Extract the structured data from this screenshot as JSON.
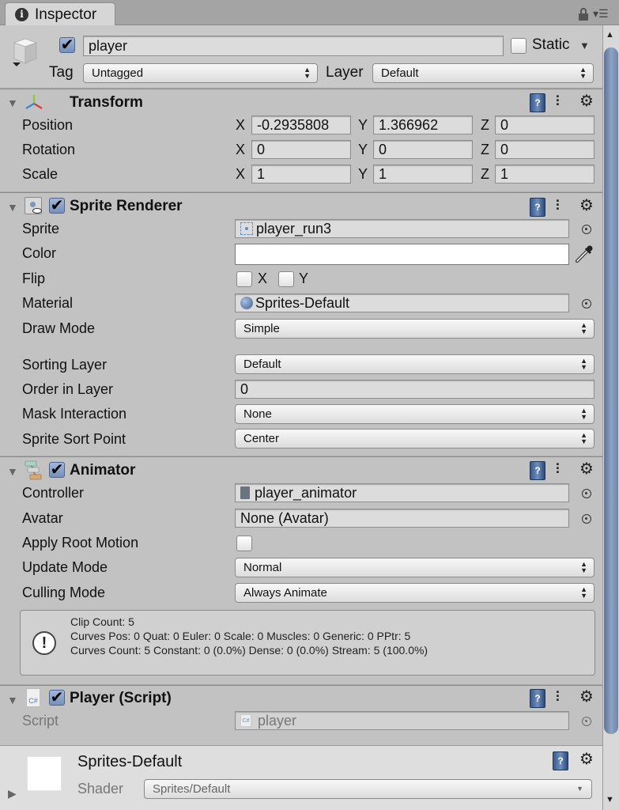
{
  "window": {
    "tab_label": "Inspector",
    "icons": [
      "info-icon",
      "lock-icon",
      "menu-icon"
    ]
  },
  "gameobject": {
    "active": true,
    "name": "player",
    "static_label": "Static",
    "static": false,
    "tag_label": "Tag",
    "tag_value": "Untagged",
    "layer_label": "Layer",
    "layer_value": "Default"
  },
  "transform": {
    "title": "Transform",
    "rows": [
      {
        "label": "Position",
        "x": "-0.2935808",
        "y": "1.366962",
        "z": "0"
      },
      {
        "label": "Rotation",
        "x": "0",
        "y": "0",
        "z": "0"
      },
      {
        "label": "Scale",
        "x": "1",
        "y": "1",
        "z": "1"
      }
    ],
    "axis_labels": {
      "x": "X",
      "y": "Y",
      "z": "Z"
    }
  },
  "sprite_renderer": {
    "title": "Sprite Renderer",
    "enabled": true,
    "sprite_label": "Sprite",
    "sprite_value": "player_run3",
    "color_label": "Color",
    "color_value": "#FFFFFF",
    "flip_label": "Flip",
    "flip_x_label": "X",
    "flip_y_label": "Y",
    "flip_x": false,
    "flip_y": false,
    "material_label": "Material",
    "material_value": "Sprites-Default",
    "draw_mode_label": "Draw Mode",
    "draw_mode_value": "Simple",
    "sorting_layer_label": "Sorting Layer",
    "sorting_layer_value": "Default",
    "order_label": "Order in Layer",
    "order_value": "0",
    "mask_label": "Mask Interaction",
    "mask_value": "None",
    "sort_point_label": "Sprite Sort Point",
    "sort_point_value": "Center"
  },
  "animator": {
    "title": "Animator",
    "enabled": true,
    "controller_label": "Controller",
    "controller_value": "player_animator",
    "avatar_label": "Avatar",
    "avatar_value": "None (Avatar)",
    "root_motion_label": "Apply Root Motion",
    "root_motion": false,
    "update_mode_label": "Update Mode",
    "update_mode_value": "Normal",
    "culling_mode_label": "Culling Mode",
    "culling_mode_value": "Always Animate",
    "info_lines": [
      "Clip Count: 5",
      "Curves Pos: 0 Quat: 0 Euler: 0 Scale: 0 Muscles: 0 Generic: 0 PPtr: 5",
      "Curves Count: 5 Constant: 0 (0.0%) Dense: 0 (0.0%) Stream: 5 (100.0%)"
    ]
  },
  "player_script": {
    "title": "Player (Script)",
    "enabled": true,
    "script_label": "Script",
    "script_value": "player",
    "script_icon_text": "C#"
  },
  "material": {
    "title": "Sprites-Default",
    "shader_label": "Shader",
    "shader_value": "Sprites/Default"
  },
  "glyphs": {
    "check": "✔",
    "foldout_open": "▼",
    "foldout_closed": "▶",
    "popup_arrows": "▲▼",
    "dropdown": "▼",
    "gear": "⚙",
    "book": "?",
    "warn": "!",
    "scroll_up": "▲",
    "scroll_down": "▼",
    "info": "i",
    "menu": "▾☰"
  },
  "colors": {
    "panel_bg": "#c2c2c2",
    "tab_bar": "#a4a4a4",
    "checkbox_accent": "#7590bc",
    "scroll_thumb": "#7a8fb2"
  }
}
